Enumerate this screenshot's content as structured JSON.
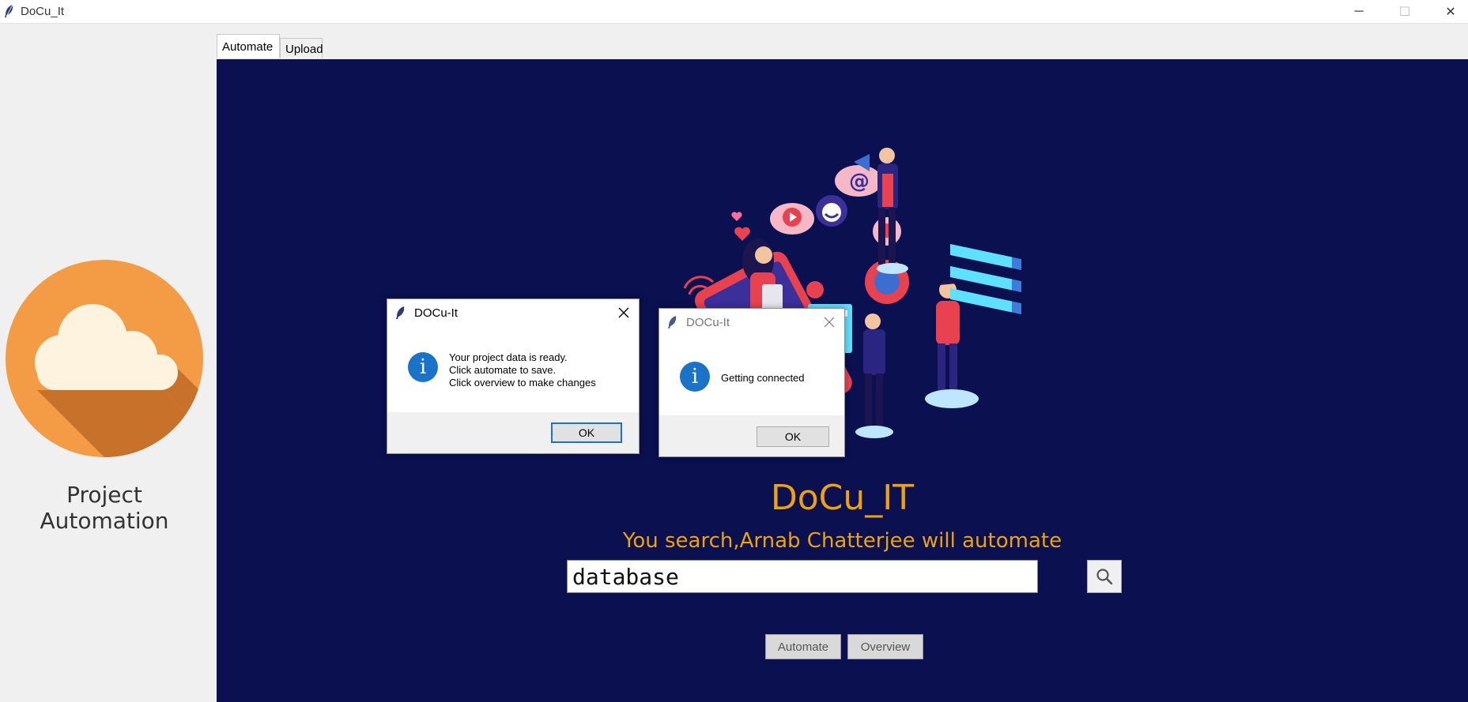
{
  "window": {
    "title": "DoCu_It",
    "min_glyph": "─",
    "max_glyph": "☐",
    "close_glyph": "✕"
  },
  "sidebar": {
    "logo_icon": "cloud-icon",
    "caption": "Project Automation"
  },
  "tabs": [
    {
      "label": "Automate",
      "active": true
    },
    {
      "label": "Upload",
      "active": false
    }
  ],
  "main": {
    "illustration": "social-media-illustration",
    "heading": "DoCu_IT",
    "subtitle": "You search,Arnab Chatterjee will automate",
    "search": {
      "value": "database",
      "icon": "search-icon"
    },
    "automate_label": "Automate",
    "overview_label": "Overview"
  },
  "dialogs": [
    {
      "title": "DOCu-It",
      "message": "Your project data is ready.\nClick automate to save.\nClick overview to make changes",
      "ok_label": "OK",
      "icon": "info-icon",
      "active": true
    },
    {
      "title": "DOCu-It",
      "message": "Getting connected",
      "ok_label": "OK",
      "icon": "info-icon",
      "active": false
    }
  ],
  "colors": {
    "main_bg": "#0a1050",
    "accent": "#f0a20a",
    "logo_bg": "#f39c45",
    "info_blue": "#1a73c9"
  }
}
